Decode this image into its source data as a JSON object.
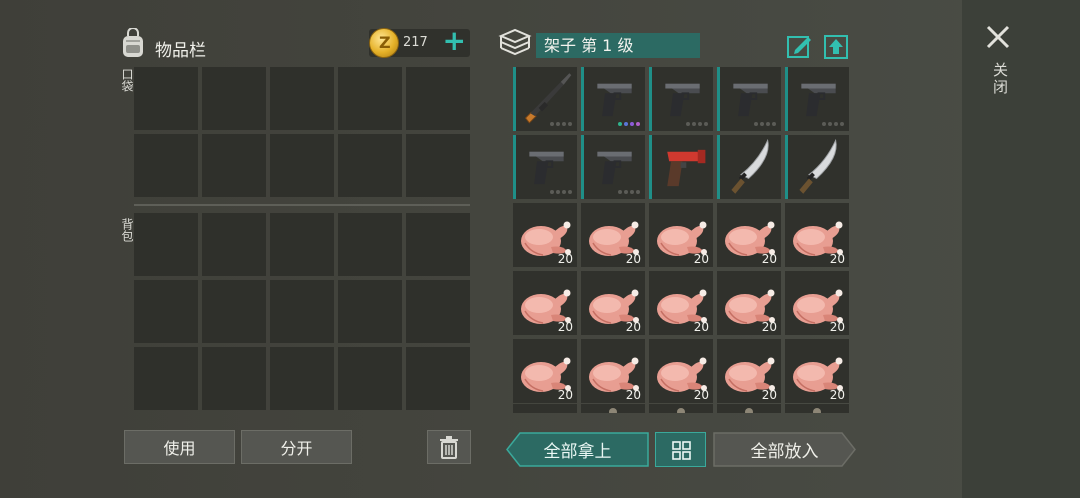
{
  "inventory": {
    "title": "物品栏",
    "coins": "217",
    "pocket_label": "口袋",
    "backpack_label": "背包",
    "use_label": "使用",
    "split_label": "分开"
  },
  "shelf": {
    "title": "架子 第 1 级",
    "items": [
      {
        "type": "rifle",
        "dots": "gray"
      },
      {
        "type": "pistol",
        "dots": "colored"
      },
      {
        "type": "pistol",
        "dots": "gray"
      },
      {
        "type": "pistol",
        "dots": "gray"
      },
      {
        "type": "pistol",
        "dots": "gray"
      },
      {
        "type": "pistol",
        "dots": "gray"
      },
      {
        "type": "pistol",
        "dots": "gray"
      },
      {
        "type": "flare-gun",
        "dots": ""
      },
      {
        "type": "machete",
        "dots": ""
      },
      {
        "type": "machete",
        "dots": ""
      },
      {
        "type": "chicken",
        "qty": "20"
      },
      {
        "type": "chicken",
        "qty": "20"
      },
      {
        "type": "chicken",
        "qty": "20"
      },
      {
        "type": "chicken",
        "qty": "20"
      },
      {
        "type": "chicken",
        "qty": "20"
      },
      {
        "type": "chicken",
        "qty": "20"
      },
      {
        "type": "chicken",
        "qty": "20"
      },
      {
        "type": "chicken",
        "qty": "20"
      },
      {
        "type": "chicken",
        "qty": "20"
      },
      {
        "type": "chicken",
        "qty": "20"
      },
      {
        "type": "chicken",
        "qty": "20"
      },
      {
        "type": "chicken",
        "qty": "20"
      },
      {
        "type": "chicken",
        "qty": "20"
      },
      {
        "type": "chicken",
        "qty": "20"
      },
      {
        "type": "chicken",
        "qty": "20"
      }
    ],
    "take_all_label": "全部拿上",
    "put_all_label": "全部放入"
  },
  "close_label": "关闭",
  "colors": {
    "accent": "#2c6a63",
    "accent_bright": "#32bfb0",
    "slot": "#2f302b"
  }
}
